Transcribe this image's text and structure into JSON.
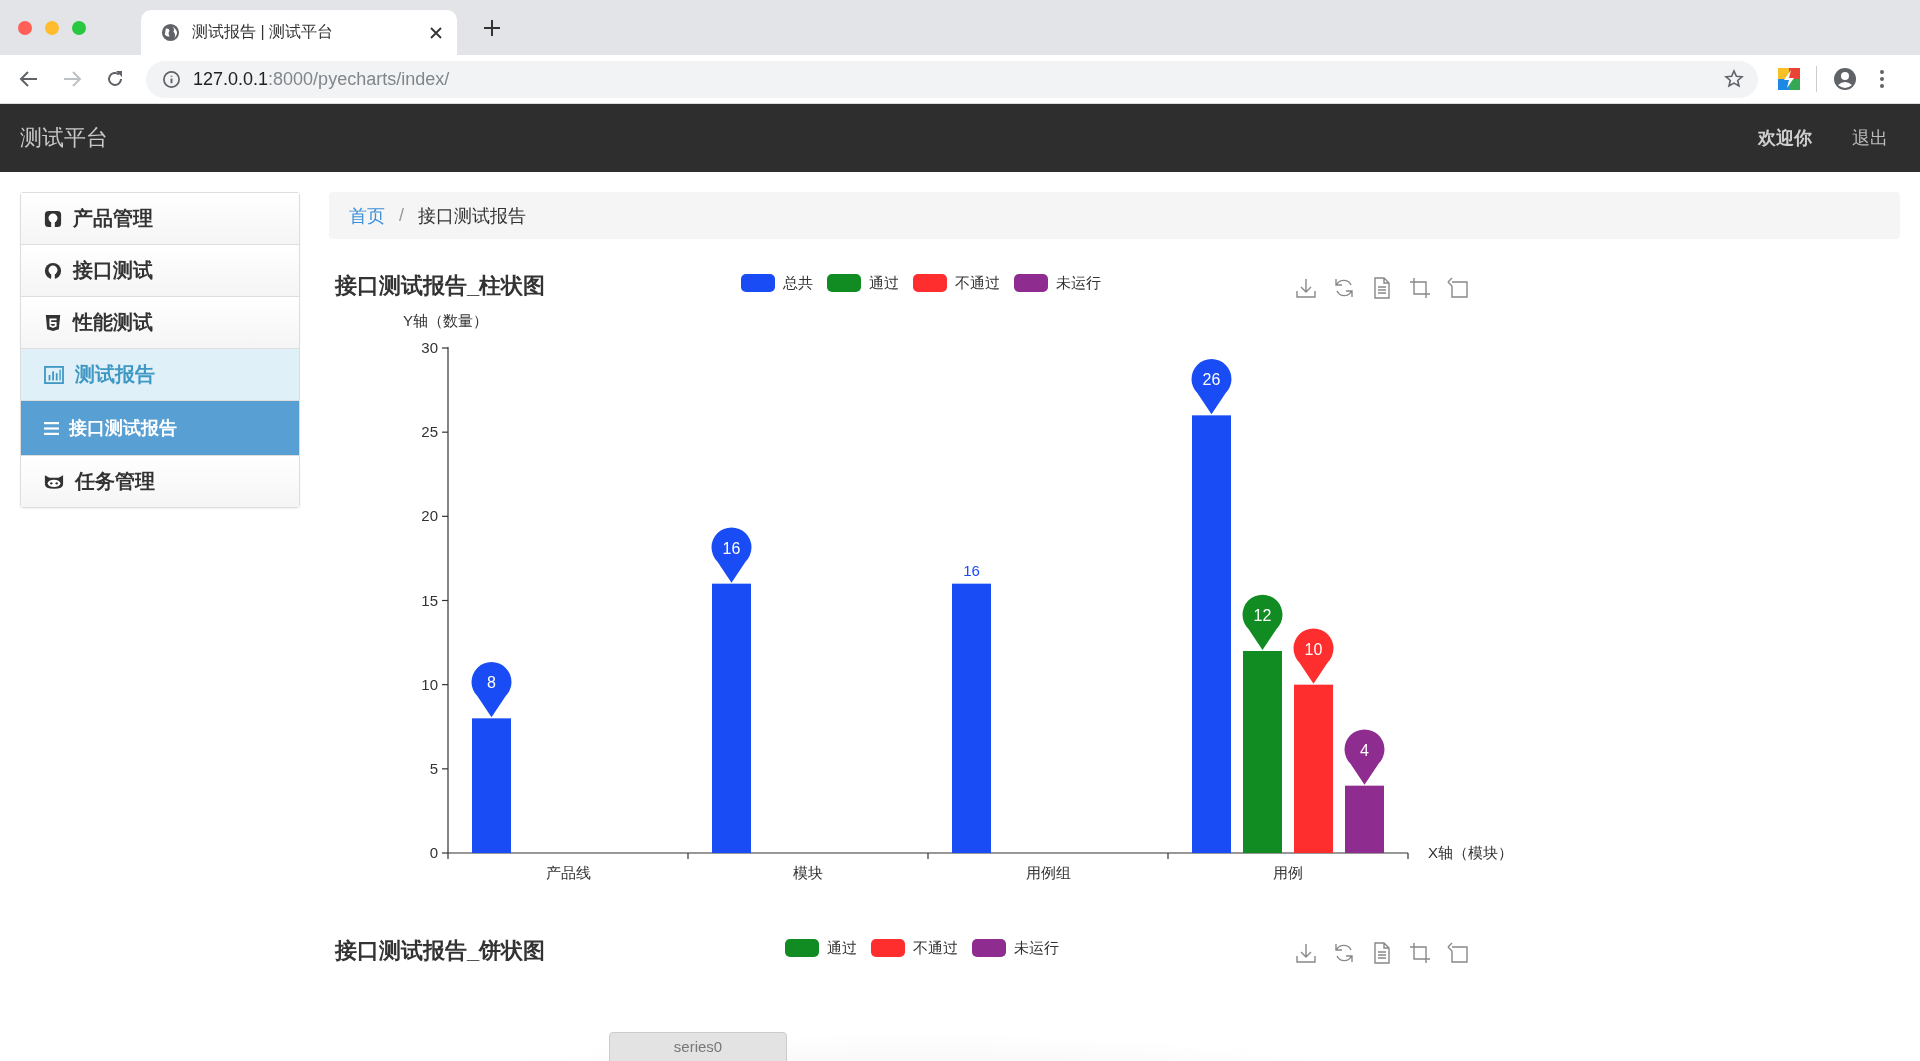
{
  "browser": {
    "tab_title": "测试报告 | 测试平台",
    "url_host": "127.0.0.1",
    "url_path": ":8000/pyecharts/index/"
  },
  "navbar": {
    "brand": "测试平台",
    "links": [
      "欢迎你",
      "退出"
    ]
  },
  "sidebar": {
    "items": [
      {
        "label": "产品管理",
        "selected": false,
        "expanded": false
      },
      {
        "label": "接口测试",
        "selected": false,
        "expanded": false
      },
      {
        "label": "性能测试",
        "selected": false,
        "expanded": false
      },
      {
        "label": "测试报告",
        "selected": false,
        "expanded": true,
        "children": [
          {
            "label": "接口测试报告",
            "selected": true
          }
        ]
      },
      {
        "label": "任务管理",
        "selected": false,
        "expanded": false
      }
    ]
  },
  "breadcrumb": {
    "items": [
      "首页",
      "接口测试报告"
    ],
    "separator": "/"
  },
  "bar_chart": {
    "title": "接口测试报告_柱状图",
    "chart_data": {
      "type": "bar",
      "ylabel": "Y轴（数量）",
      "xlabel": "X轴（模块）",
      "categories": [
        "产品线",
        "模块",
        "用例组",
        "用例"
      ],
      "ylim": [
        0,
        30
      ],
      "yticks": [
        0,
        5,
        10,
        15,
        20,
        25,
        30
      ],
      "value_labels": [
        [
          "8",
          "16",
          "16",
          "26"
        ],
        [
          null,
          null,
          null,
          "12"
        ],
        [
          null,
          null,
          null,
          "10"
        ],
        [
          null,
          null,
          null,
          "4"
        ]
      ],
      "series": [
        {
          "name": "总共",
          "color": "#1a4cf5",
          "values": [
            8,
            16,
            16,
            26
          ]
        },
        {
          "name": "通过",
          "color": "#108c22",
          "values": [
            0,
            0,
            0,
            12
          ]
        },
        {
          "name": "不通过",
          "color": "#ff2e2e",
          "values": [
            0,
            0,
            0,
            10
          ]
        },
        {
          "name": "未运行",
          "color": "#8f2c8f",
          "values": [
            0,
            0,
            0,
            4
          ]
        }
      ]
    }
  },
  "pie_chart": {
    "title": "接口测试报告_饼状图",
    "legend": [
      {
        "name": "通过",
        "color": "#108c22"
      },
      {
        "name": "不通过",
        "color": "#ff2e2e"
      },
      {
        "name": "未运行",
        "color": "#8f2c8f"
      }
    ],
    "series_label": "series0"
  }
}
